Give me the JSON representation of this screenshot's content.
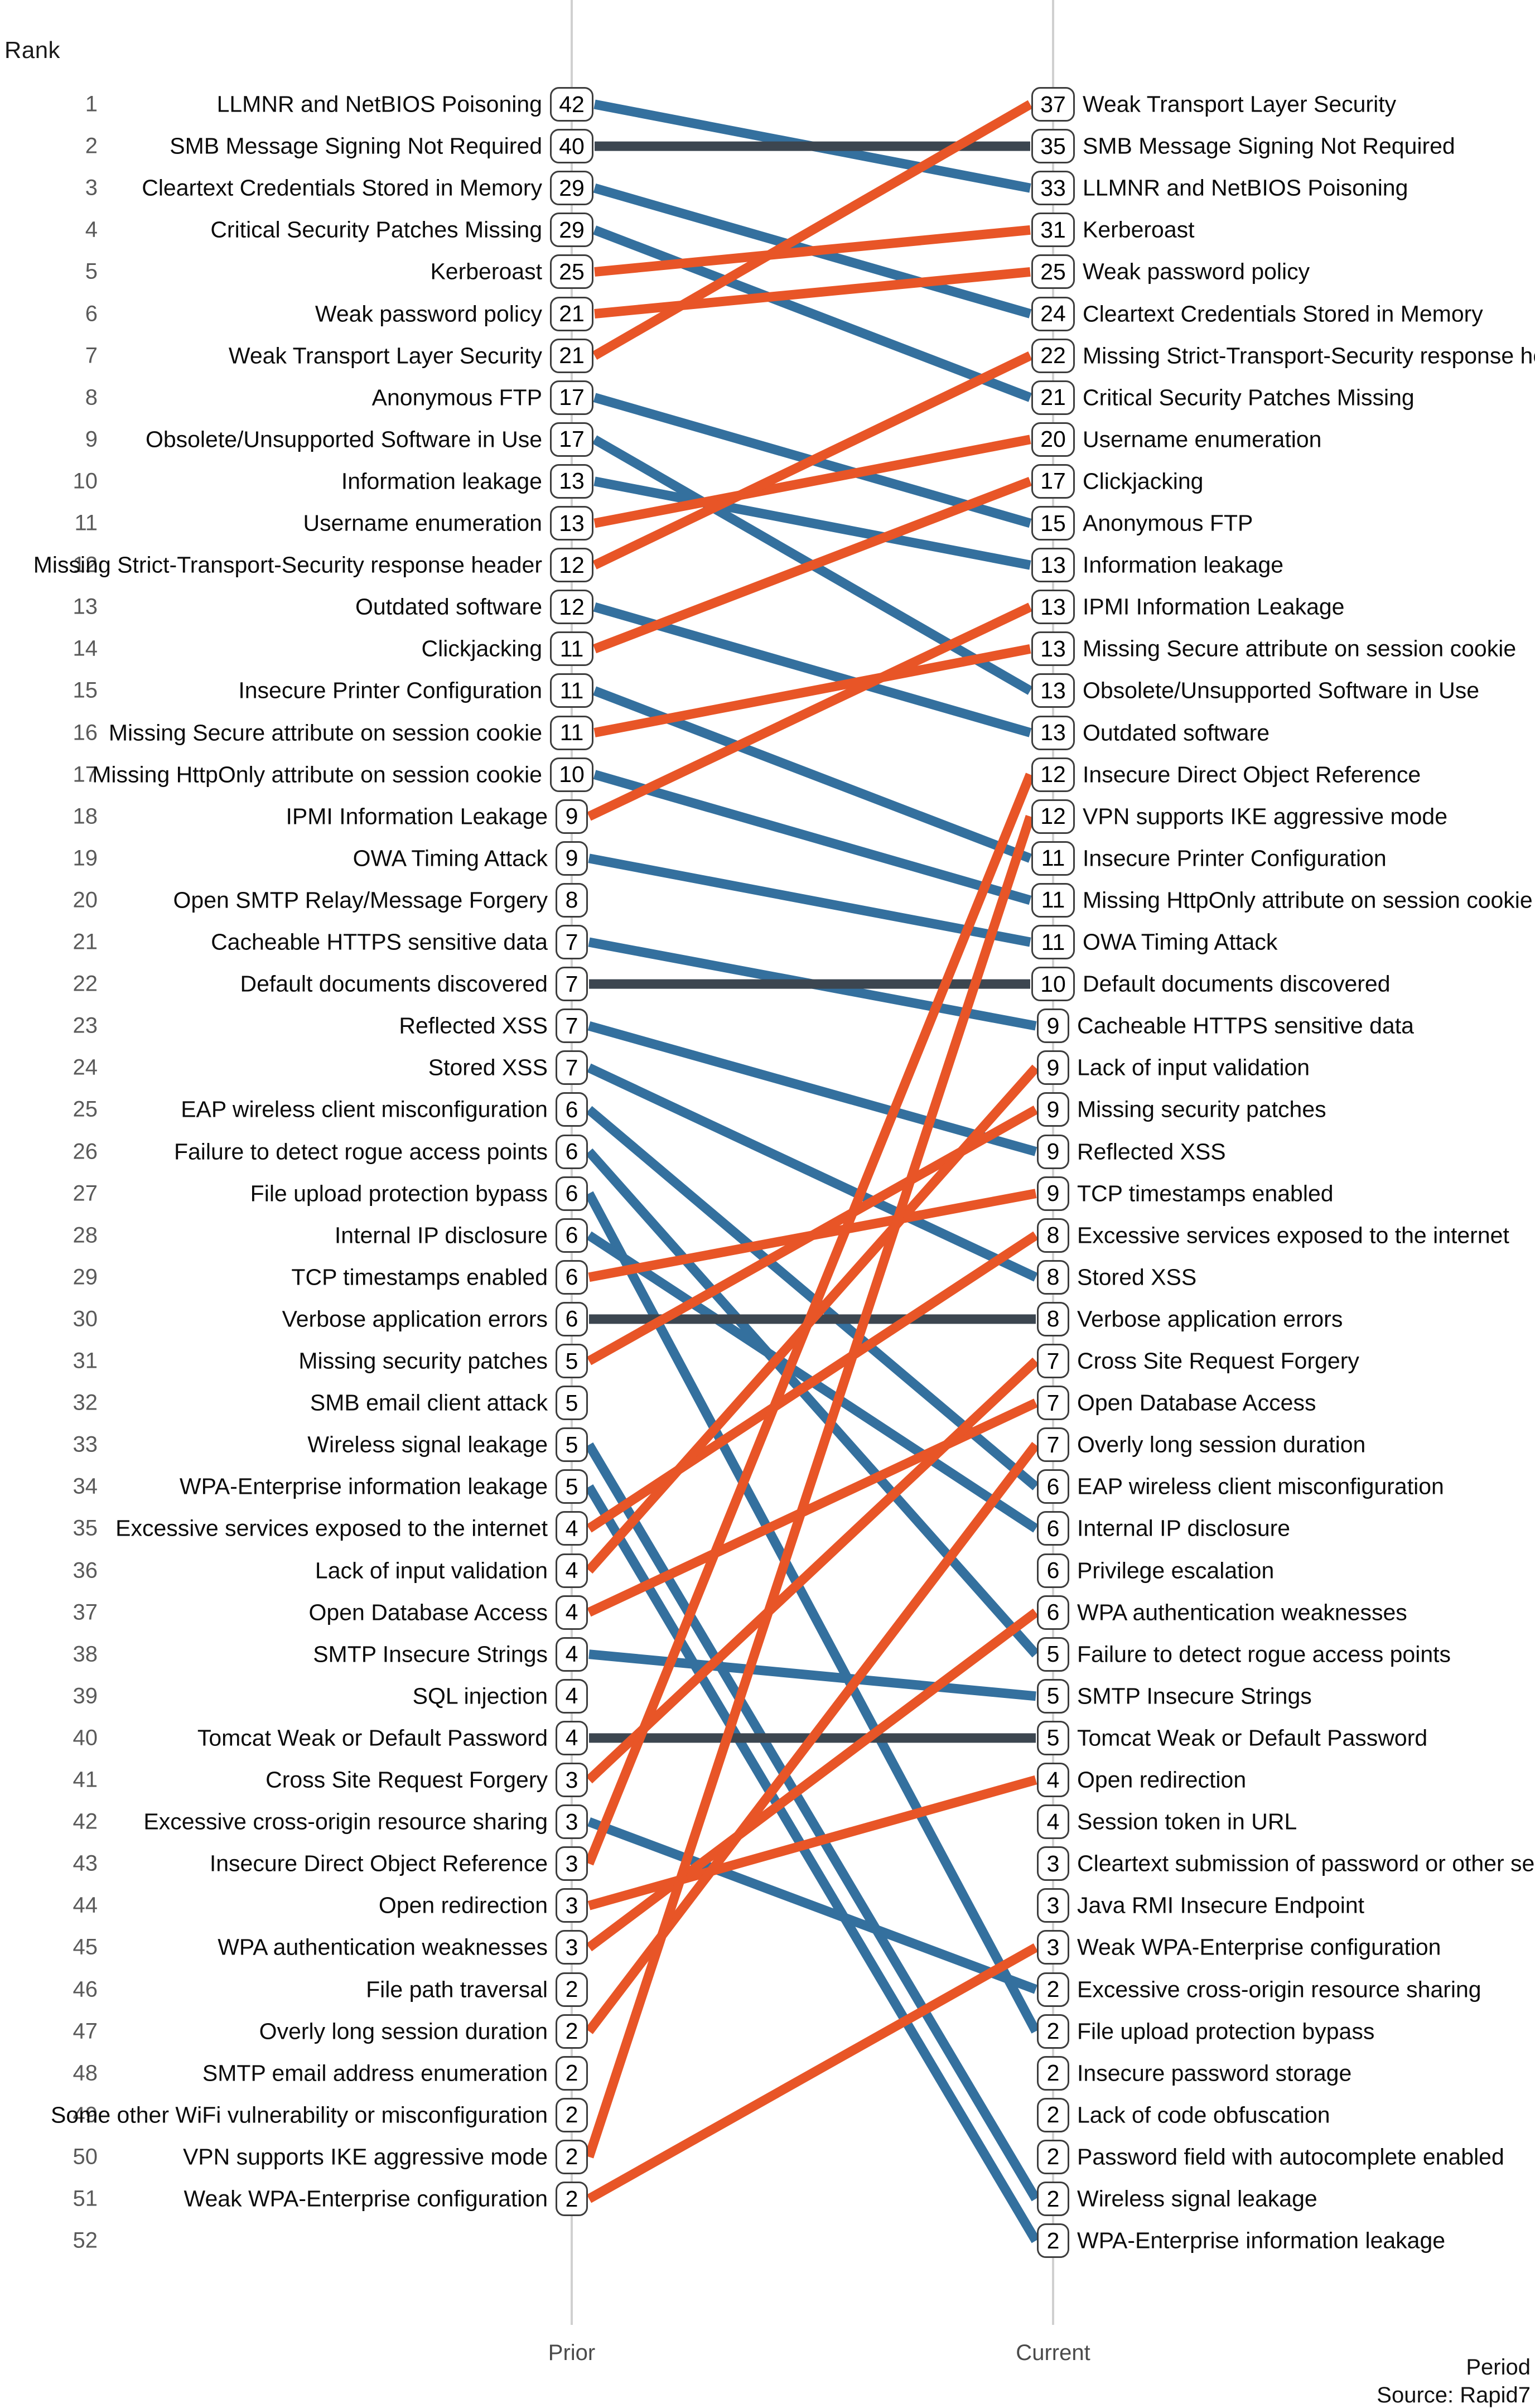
{
  "axis": {
    "rank_title": "Rank",
    "period_title": "Period",
    "prior_label": "Prior",
    "current_label": "Current",
    "source": "Source: Rapid7"
  },
  "ranks": [
    1,
    2,
    3,
    4,
    5,
    6,
    7,
    8,
    9,
    10,
    11,
    12,
    13,
    14,
    15,
    16,
    17,
    18,
    19,
    20,
    21,
    22,
    23,
    24,
    25,
    26,
    27,
    28,
    29,
    30,
    31,
    32,
    33,
    34,
    35,
    36,
    37,
    38,
    39,
    40,
    41,
    42,
    43,
    44,
    45,
    46,
    47,
    48,
    49,
    50,
    51,
    52
  ],
  "colors": {
    "up": "#E85527",
    "down": "#34709E",
    "same": "#3C4650",
    "axis": "#d0d0d0",
    "box_border": "#3d3d3d",
    "text": "#0b0b0b",
    "rank_text": "#5a5a5a"
  },
  "chart_data": {
    "type": "line",
    "title": "",
    "subtitle": "",
    "xlabel": "Period",
    "ylabel": "Rank",
    "x": [
      "Prior",
      "Current"
    ],
    "ylim": [
      1,
      52
    ],
    "grid": false,
    "legend": null,
    "annotation": "Source: Rapid7",
    "encoding": {
      "rank_rises_orange": "#E85527",
      "rank_falls_blue": "#34709E",
      "rank_unchanged_dark": "#3C4650"
    },
    "prior": [
      {
        "rank": 1,
        "label": "LLMNR and NetBIOS Poisoning",
        "value": 42
      },
      {
        "rank": 2,
        "label": "SMB Message Signing Not Required",
        "value": 40
      },
      {
        "rank": 3,
        "label": "Cleartext Credentials Stored in Memory",
        "value": 29
      },
      {
        "rank": 4,
        "label": "Critical Security Patches Missing",
        "value": 29
      },
      {
        "rank": 5,
        "label": "Kerberoast",
        "value": 25
      },
      {
        "rank": 6,
        "label": "Weak password policy",
        "value": 21
      },
      {
        "rank": 7,
        "label": "Weak Transport Layer Security",
        "value": 21
      },
      {
        "rank": 8,
        "label": "Anonymous FTP",
        "value": 17
      },
      {
        "rank": 9,
        "label": "Obsolete/Unsupported Software in Use",
        "value": 17
      },
      {
        "rank": 10,
        "label": "Information leakage",
        "value": 13
      },
      {
        "rank": 11,
        "label": "Username enumeration",
        "value": 13
      },
      {
        "rank": 12,
        "label": "Missing Strict-Transport-Security response header",
        "value": 12
      },
      {
        "rank": 13,
        "label": "Outdated software",
        "value": 12
      },
      {
        "rank": 14,
        "label": "Clickjacking",
        "value": 11
      },
      {
        "rank": 15,
        "label": "Insecure Printer Configuration",
        "value": 11
      },
      {
        "rank": 16,
        "label": "Missing Secure attribute on session cookie",
        "value": 11
      },
      {
        "rank": 17,
        "label": "Missing HttpOnly attribute on session cookie",
        "value": 10
      },
      {
        "rank": 18,
        "label": "IPMI Information Leakage",
        "value": 9
      },
      {
        "rank": 19,
        "label": "OWA Timing Attack",
        "value": 9
      },
      {
        "rank": 20,
        "label": "Open SMTP Relay/Message Forgery",
        "value": 8
      },
      {
        "rank": 21,
        "label": "Cacheable HTTPS sensitive data",
        "value": 7
      },
      {
        "rank": 22,
        "label": "Default documents discovered",
        "value": 7
      },
      {
        "rank": 23,
        "label": "Reflected XSS",
        "value": 7
      },
      {
        "rank": 24,
        "label": "Stored XSS",
        "value": 7
      },
      {
        "rank": 25,
        "label": "EAP wireless client misconfiguration",
        "value": 6
      },
      {
        "rank": 26,
        "label": "Failure to detect rogue access points",
        "value": 6
      },
      {
        "rank": 27,
        "label": "File upload protection bypass",
        "value": 6
      },
      {
        "rank": 28,
        "label": "Internal IP disclosure",
        "value": 6
      },
      {
        "rank": 29,
        "label": "TCP timestamps enabled",
        "value": 6
      },
      {
        "rank": 30,
        "label": "Verbose application errors",
        "value": 6
      },
      {
        "rank": 31,
        "label": "Missing security patches",
        "value": 5
      },
      {
        "rank": 32,
        "label": "SMB email client attack",
        "value": 5
      },
      {
        "rank": 33,
        "label": "Wireless signal leakage",
        "value": 5
      },
      {
        "rank": 34,
        "label": "WPA-Enterprise information leakage",
        "value": 5
      },
      {
        "rank": 35,
        "label": "Excessive services exposed to the internet",
        "value": 4
      },
      {
        "rank": 36,
        "label": "Lack of input validation",
        "value": 4
      },
      {
        "rank": 37,
        "label": "Open Database Access",
        "value": 4
      },
      {
        "rank": 38,
        "label": "SMTP Insecure Strings",
        "value": 4
      },
      {
        "rank": 39,
        "label": "SQL injection",
        "value": 4
      },
      {
        "rank": 40,
        "label": "Tomcat Weak or Default Password",
        "value": 4
      },
      {
        "rank": 41,
        "label": "Cross Site Request Forgery",
        "value": 3
      },
      {
        "rank": 42,
        "label": "Excessive cross-origin resource sharing",
        "value": 3
      },
      {
        "rank": 43,
        "label": "Insecure Direct Object Reference",
        "value": 3
      },
      {
        "rank": 44,
        "label": "Open redirection",
        "value": 3
      },
      {
        "rank": 45,
        "label": "WPA authentication weaknesses",
        "value": 3
      },
      {
        "rank": 46,
        "label": "File path traversal",
        "value": 2
      },
      {
        "rank": 47,
        "label": "Overly long session duration",
        "value": 2
      },
      {
        "rank": 48,
        "label": "SMTP email address enumeration",
        "value": 2
      },
      {
        "rank": 49,
        "label": "Some other WiFi vulnerability or misconfiguration",
        "value": 2
      },
      {
        "rank": 50,
        "label": "VPN supports IKE aggressive mode",
        "value": 2
      },
      {
        "rank": 51,
        "label": "Weak WPA-Enterprise configuration",
        "value": 2
      }
    ],
    "current": [
      {
        "rank": 1,
        "label": "Weak Transport Layer Security",
        "value": 37
      },
      {
        "rank": 2,
        "label": "SMB Message Signing Not Required",
        "value": 35
      },
      {
        "rank": 3,
        "label": "LLMNR and NetBIOS Poisoning",
        "value": 33
      },
      {
        "rank": 4,
        "label": "Kerberoast",
        "value": 31
      },
      {
        "rank": 5,
        "label": "Weak password policy",
        "value": 25
      },
      {
        "rank": 6,
        "label": "Cleartext Credentials Stored in Memory",
        "value": 24
      },
      {
        "rank": 7,
        "label": "Missing Strict-Transport-Security response header",
        "value": 22
      },
      {
        "rank": 8,
        "label": "Critical Security Patches Missing",
        "value": 21
      },
      {
        "rank": 9,
        "label": "Username enumeration",
        "value": 20
      },
      {
        "rank": 10,
        "label": "Clickjacking",
        "value": 17
      },
      {
        "rank": 11,
        "label": "Anonymous FTP",
        "value": 15
      },
      {
        "rank": 12,
        "label": "Information leakage",
        "value": 13
      },
      {
        "rank": 13,
        "label": "IPMI Information Leakage",
        "value": 13
      },
      {
        "rank": 14,
        "label": "Missing Secure attribute on session cookie",
        "value": 13
      },
      {
        "rank": 15,
        "label": "Obsolete/Unsupported Software in Use",
        "value": 13
      },
      {
        "rank": 16,
        "label": "Outdated software",
        "value": 13
      },
      {
        "rank": 17,
        "label": "Insecure Direct Object Reference",
        "value": 12
      },
      {
        "rank": 18,
        "label": "VPN supports IKE aggressive mode",
        "value": 12
      },
      {
        "rank": 19,
        "label": "Insecure Printer Configuration",
        "value": 11
      },
      {
        "rank": 20,
        "label": "Missing HttpOnly attribute on session cookie",
        "value": 11
      },
      {
        "rank": 21,
        "label": "OWA Timing Attack",
        "value": 11
      },
      {
        "rank": 22,
        "label": "Default documents discovered",
        "value": 10
      },
      {
        "rank": 23,
        "label": "Cacheable HTTPS sensitive data",
        "value": 9
      },
      {
        "rank": 24,
        "label": "Lack of input validation",
        "value": 9
      },
      {
        "rank": 25,
        "label": "Missing security patches",
        "value": 9
      },
      {
        "rank": 26,
        "label": "Reflected XSS",
        "value": 9
      },
      {
        "rank": 27,
        "label": "TCP timestamps enabled",
        "value": 9
      },
      {
        "rank": 28,
        "label": "Excessive services exposed to the internet",
        "value": 8
      },
      {
        "rank": 29,
        "label": "Stored XSS",
        "value": 8
      },
      {
        "rank": 30,
        "label": "Verbose application errors",
        "value": 8
      },
      {
        "rank": 31,
        "label": "Cross Site Request Forgery",
        "value": 7
      },
      {
        "rank": 32,
        "label": "Open Database Access",
        "value": 7
      },
      {
        "rank": 33,
        "label": "Overly long session duration",
        "value": 7
      },
      {
        "rank": 34,
        "label": "EAP wireless client misconfiguration",
        "value": 6
      },
      {
        "rank": 35,
        "label": "Internal IP disclosure",
        "value": 6
      },
      {
        "rank": 36,
        "label": "Privilege escalation",
        "value": 6
      },
      {
        "rank": 37,
        "label": "WPA authentication weaknesses",
        "value": 6
      },
      {
        "rank": 38,
        "label": "Failure to detect rogue access points",
        "value": 5
      },
      {
        "rank": 39,
        "label": "SMTP Insecure Strings",
        "value": 5
      },
      {
        "rank": 40,
        "label": "Tomcat Weak or Default Password",
        "value": 5
      },
      {
        "rank": 41,
        "label": "Open redirection",
        "value": 4
      },
      {
        "rank": 42,
        "label": "Session token in URL",
        "value": 4
      },
      {
        "rank": 43,
        "label": "Cleartext submission of password or other sensitive d",
        "value": 3
      },
      {
        "rank": 44,
        "label": "Java RMI Insecure Endpoint",
        "value": 3
      },
      {
        "rank": 45,
        "label": "Weak WPA-Enterprise configuration",
        "value": 3
      },
      {
        "rank": 46,
        "label": "Excessive cross-origin resource sharing",
        "value": 2
      },
      {
        "rank": 47,
        "label": "File upload protection bypass",
        "value": 2
      },
      {
        "rank": 48,
        "label": "Insecure password storage",
        "value": 2
      },
      {
        "rank": 49,
        "label": "Lack of code obfuscation",
        "value": 2
      },
      {
        "rank": 50,
        "label": "Password field with autocomplete enabled",
        "value": 2
      },
      {
        "rank": 51,
        "label": "Wireless signal leakage",
        "value": 2
      },
      {
        "rank": 52,
        "label": "WPA-Enterprise information leakage",
        "value": 2
      }
    ]
  }
}
